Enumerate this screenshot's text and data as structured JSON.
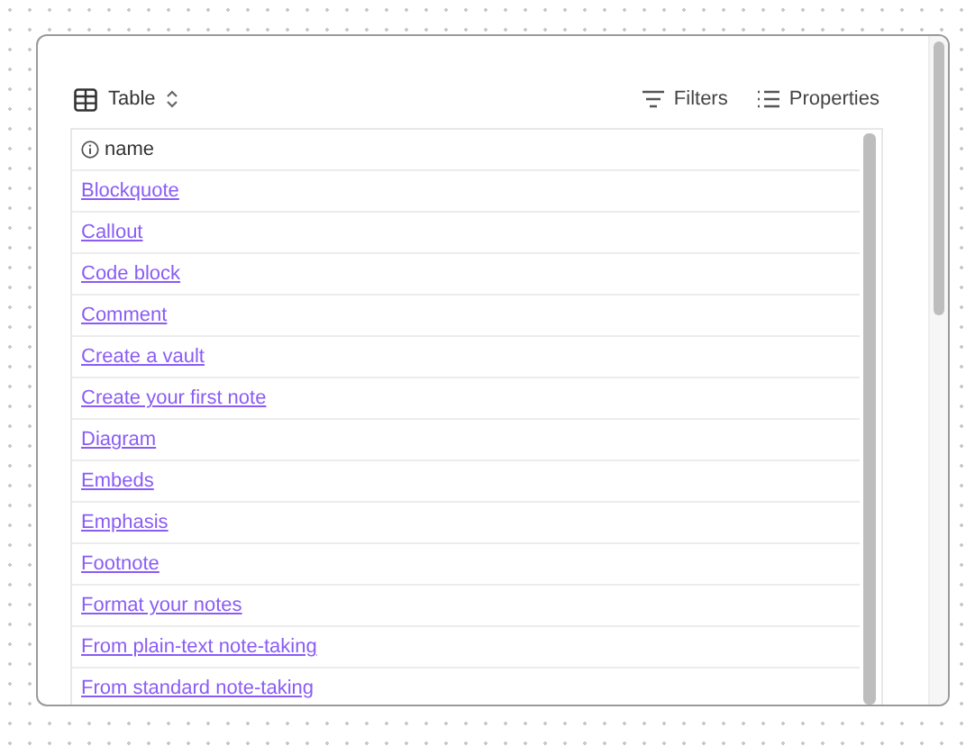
{
  "toolbar": {
    "view": "Table",
    "actions": [
      {
        "kind": "filter",
        "label": "Filters"
      },
      {
        "kind": "list",
        "label": "Properties"
      }
    ]
  },
  "table": {
    "column": "name",
    "rows": [
      "Blockquote",
      "Callout",
      "Code block",
      "Comment",
      "Create a vault",
      "Create your first note",
      "Diagram",
      "Embeds",
      "Emphasis",
      "Footnote",
      "Format your notes",
      "From plain-text note-taking",
      "From standard note-taking"
    ]
  }
}
